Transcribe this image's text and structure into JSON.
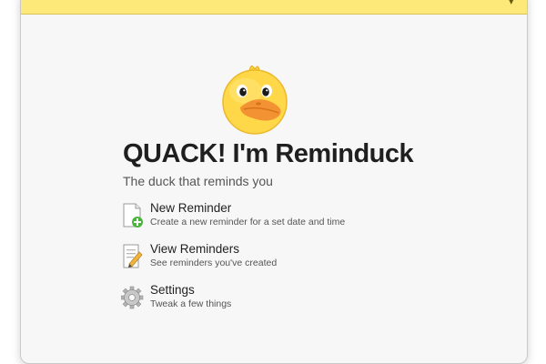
{
  "app": {
    "title": "QUACK! I'm Reminduck",
    "subtitle": "The duck that reminds you",
    "mascot_icon": "duck-mascot-icon",
    "topbar_color": "#fde97a"
  },
  "menu": {
    "items": [
      {
        "label": "New Reminder",
        "description": "Create a new reminder for a set date and time",
        "icon": "new-document-icon"
      },
      {
        "label": "View Reminders",
        "description": "See reminders you've created",
        "icon": "edit-document-icon"
      },
      {
        "label": "Settings",
        "description": "Tweak a few things",
        "icon": "gear-icon"
      }
    ]
  }
}
